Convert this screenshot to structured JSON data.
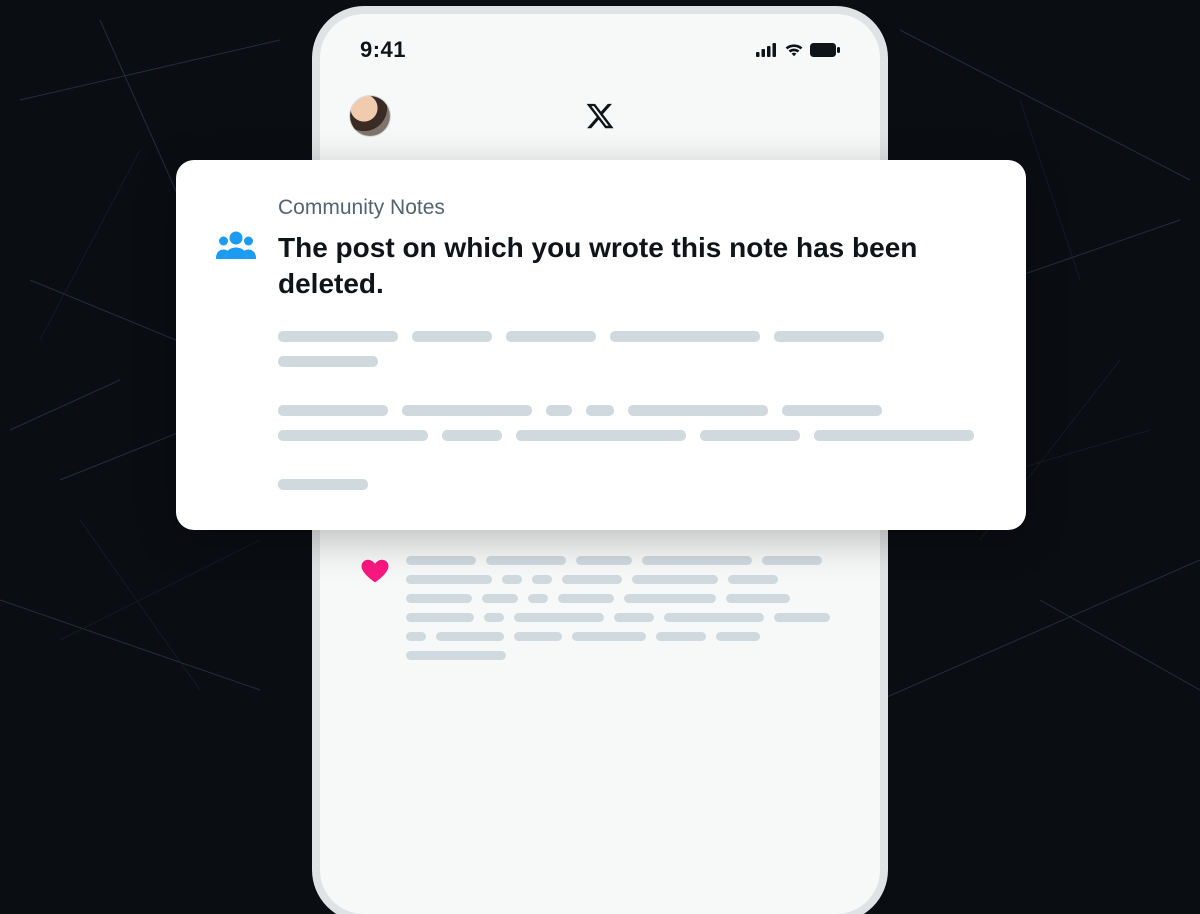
{
  "status": {
    "time": "9:41"
  },
  "card": {
    "label": "Community Notes",
    "headline": "The post on which you wrote this note has been deleted."
  },
  "colors": {
    "community_notes_icon": "#1d9bf0",
    "heart_icon": "#f91880"
  }
}
